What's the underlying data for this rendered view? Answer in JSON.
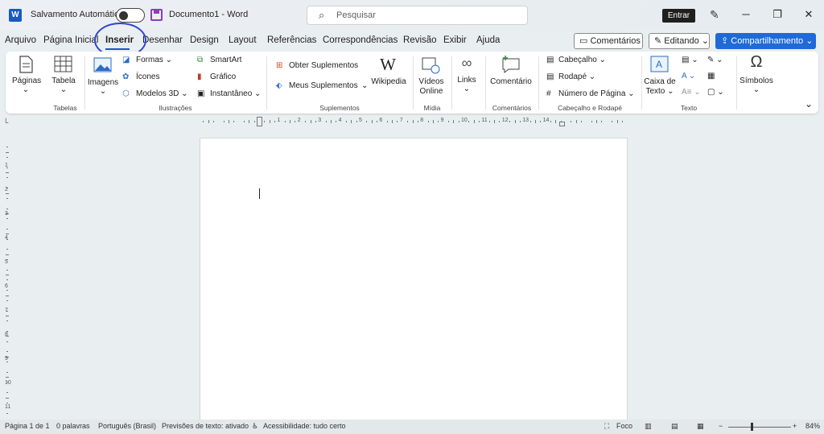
{
  "titlebar": {
    "autosave_label": "Salvamento Automático",
    "doc_title": "Documento1  -  Word",
    "search_placeholder": "Pesquisar",
    "signin_label": "Entrar"
  },
  "tabs": [
    "Arquivo",
    "Página Inicial",
    "Inserir",
    "Desenhar",
    "Design",
    "Layout",
    "Referências",
    "Correspondências",
    "Revisão",
    "Exibir",
    "Ajuda"
  ],
  "active_tab": "Inserir",
  "right_buttons": {
    "comments": "Comentários",
    "editing": "Editando",
    "share": "Compartilhamento"
  },
  "ribbon": {
    "pages": "Páginas",
    "table": "Tabela",
    "images": "Imagens",
    "shapes": "Formas",
    "icons": "Ícones",
    "models3d": "Modelos 3D",
    "smartart": "SmartArt",
    "chart": "Gráfico",
    "screenshot": "Instantâneo",
    "get_addins": "Obter Suplementos",
    "my_addins": "Meus Suplementos",
    "wikipedia": "Wikipedia",
    "online_video_1": "Vídeos",
    "online_video_2": "Online",
    "links": "Links",
    "comment": "Comentário",
    "header": "Cabeçalho",
    "footer": "Rodapé",
    "page_number": "Número de Página",
    "textbox_1": "Caixa de",
    "textbox_2": "Texto",
    "symbols": "Símbolos",
    "groups": {
      "tables": "Tabelas",
      "illustrations": "Ilustrações",
      "addins": "Suplementos",
      "media": "Mídia",
      "comments": "Comentários",
      "header_footer": "Cabeçalho e Rodapé",
      "text": "Texto"
    }
  },
  "ruler": {
    "h_numbers": [
      "1",
      "2",
      "3",
      "4",
      "5",
      "6",
      "7",
      "8",
      "9",
      "10",
      "11",
      "12",
      "13",
      "14"
    ],
    "v_numbers": [
      "1",
      "2",
      "3",
      "4",
      "5",
      "6",
      "7",
      "8",
      "9",
      "10",
      "11"
    ]
  },
  "status": {
    "page": "Página 1 de 1",
    "words": "0 palavras",
    "language": "Português (Brasil)",
    "predictions": "Previsões de texto: ativado",
    "accessibility": "Acessibilidade: tudo certo",
    "focus": "Foco",
    "zoom": "84%"
  },
  "colors": {
    "accent": "#185abd",
    "share": "#1f6ad6",
    "annotation_circle": "#3046c8"
  }
}
